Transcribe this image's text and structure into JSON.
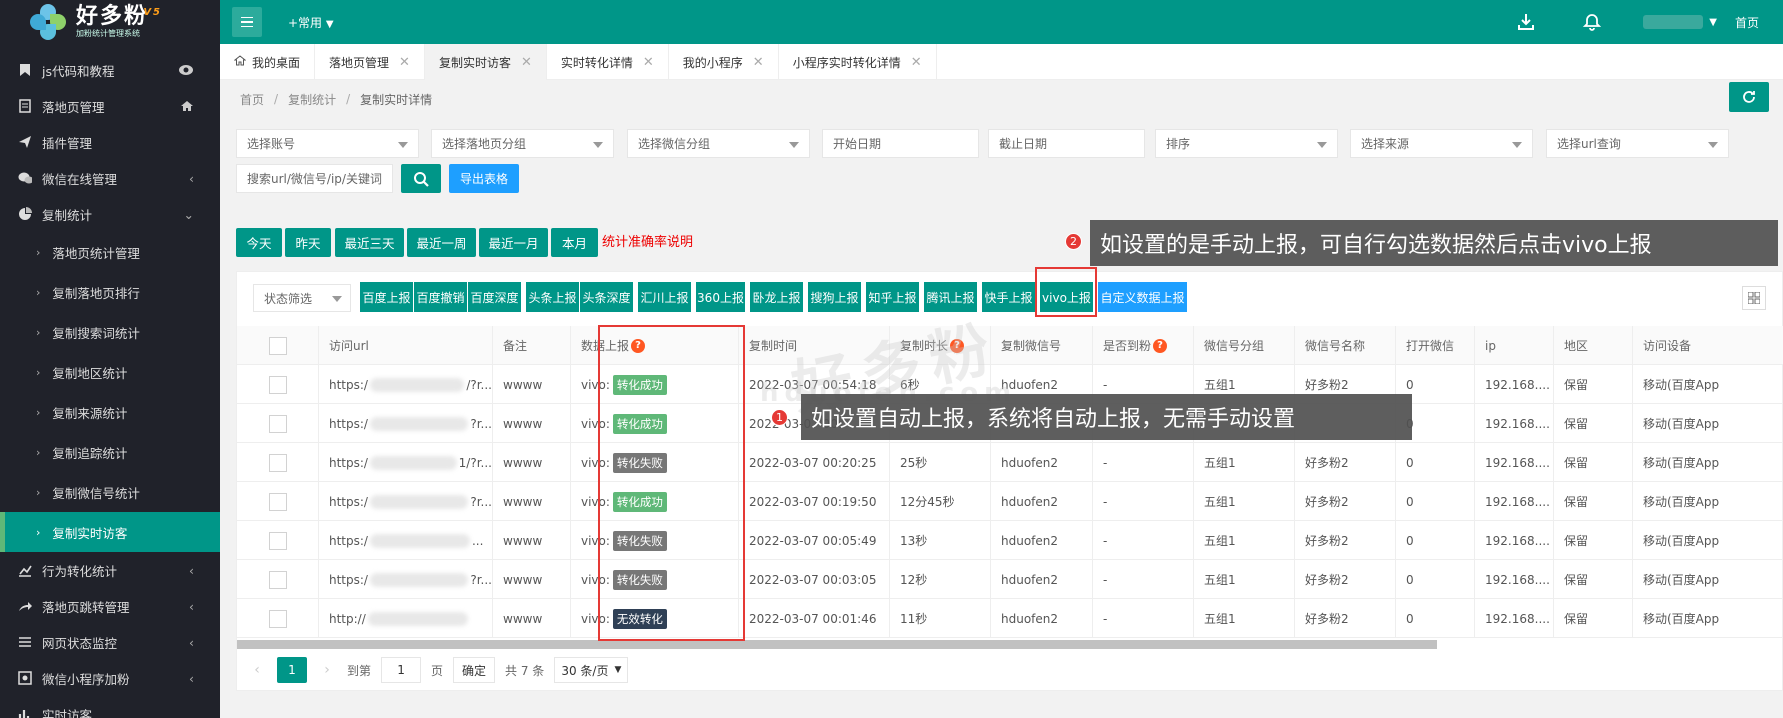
{
  "app": {
    "title": "好多粉",
    "version": "V5",
    "subtitle": "加粉统计管理系统",
    "common": "+常用",
    "home": "首页"
  },
  "sidebar": {
    "items": [
      {
        "label": "js代码和教程",
        "icon": "bookmark-icon",
        "right": "eye"
      },
      {
        "label": "落地页管理",
        "icon": "page-icon",
        "right": "home"
      },
      {
        "label": "插件管理",
        "icon": "send-icon",
        "right": ""
      },
      {
        "label": "微信在线管理",
        "icon": "wechat-icon",
        "right": "chevron"
      },
      {
        "label": "复制统计",
        "icon": "pie-icon",
        "right": "chevron-down"
      }
    ],
    "subitems": [
      "落地页统计管理",
      "复制落地页排行",
      "复制搜索词统计",
      "复制地区统计",
      "复制来源统计",
      "复制追踪统计",
      "复制微信号统计",
      "复制实时访客"
    ],
    "items2": [
      {
        "label": "行为转化统计",
        "icon": "chart-icon"
      },
      {
        "label": "落地页跳转管理",
        "icon": "share-icon"
      },
      {
        "label": "网页状态监控",
        "icon": "list-icon"
      },
      {
        "label": "微信小程序加粉",
        "icon": "mini-icon"
      },
      {
        "label": "实时访客",
        "icon": "bar-icon"
      }
    ]
  },
  "tabs": [
    {
      "label": "我的桌面",
      "close": ""
    },
    {
      "label": "落地页管理",
      "close": "✕"
    },
    {
      "label": "复制实时访客",
      "close": "✕"
    },
    {
      "label": "实时转化详情",
      "close": "✕"
    },
    {
      "label": "我的小程序",
      "close": "✕"
    },
    {
      "label": "小程序实时转化详情",
      "close": "✕"
    }
  ],
  "breadcrumb": [
    "首页",
    "复制统计",
    "复制实时详情"
  ],
  "filters": {
    "selects": [
      "选择账号",
      "选择落地页分组",
      "选择微信分组",
      "开始日期",
      "截止日期",
      "排序",
      "选择来源",
      "选择url查询"
    ],
    "search_placeholder": "搜索url/微信号/ip/关键词",
    "export": "导出表格"
  },
  "quick": [
    "今天",
    "昨天",
    "最近三天",
    "最近一周",
    "最近一月",
    "本月"
  ],
  "quick_note": "统计准确率说明",
  "status_filter": "状态筛选",
  "report_buttons": [
    "百度上报",
    "百度撤销",
    "百度深度",
    "头条上报",
    "头条深度",
    "汇川上报",
    "360上报",
    "卧龙上报",
    "搜狗上报",
    "知乎上报",
    "腾讯上报",
    "快手上报",
    "vivo上报",
    "自定义数据上报"
  ],
  "table": {
    "headers": [
      "",
      "访问url",
      "备注",
      "数据上报",
      "复制时间",
      "复制时长",
      "复制微信号",
      "是否到粉",
      "微信号分组",
      "微信号名称",
      "打开微信",
      "ip",
      "地区",
      "访问设备"
    ],
    "rows": [
      {
        "url_a": "https:/",
        "url_b": "/?r...",
        "note": "wwww",
        "report": "vivo:",
        "status": "转化成功",
        "time": "2022-03-07 00:54:18",
        "dur": "6秒",
        "wx": "hduofen2",
        "fan": "-",
        "group": "五组1",
        "name": "好多粉2",
        "open": "0",
        "ip": "192.168....",
        "region": "保留",
        "device": "移动(百度App"
      },
      {
        "url_a": "https:/",
        "url_b": "?r...",
        "note": "wwww",
        "report": "vivo:",
        "status": "转化成功",
        "time": "2022-03-07 00:",
        "dur": "",
        "wx": "",
        "fan": "",
        "group": "",
        "name": "",
        "open": "0",
        "ip": "192.168....",
        "region": "保留",
        "device": "移动(百度App"
      },
      {
        "url_a": "https:/",
        "url_b": "1/?r...",
        "note": "wwww",
        "report": "vivo:",
        "status": "转化失败",
        "time": "2022-03-07 00:20:25",
        "dur": "25秒",
        "wx": "hduofen2",
        "fan": "-",
        "group": "五组1",
        "name": "好多粉2",
        "open": "0",
        "ip": "192.168....",
        "region": "保留",
        "device": "移动(百度App"
      },
      {
        "url_a": "https:/",
        "url_b": "?r...",
        "note": "wwww",
        "report": "vivo:",
        "status": "转化成功",
        "time": "2022-03-07 00:19:50",
        "dur": "12分45秒",
        "wx": "hduofen2",
        "fan": "-",
        "group": "五组1",
        "name": "好多粉2",
        "open": "0",
        "ip": "192.168....",
        "region": "保留",
        "device": "移动(百度App"
      },
      {
        "url_a": "https:/",
        "url_b": "...",
        "note": "wwww",
        "report": "vivo:",
        "status": "转化失败",
        "time": "2022-03-07 00:05:49",
        "dur": "13秒",
        "wx": "hduofen2",
        "fan": "-",
        "group": "五组1",
        "name": "好多粉2",
        "open": "0",
        "ip": "192.168....",
        "region": "保留",
        "device": "移动(百度App"
      },
      {
        "url_a": "https:/",
        "url_b": "?r...",
        "note": "wwww",
        "report": "vivo:",
        "status": "转化失败",
        "time": "2022-03-07 00:03:05",
        "dur": "12秒",
        "wx": "hduofen2",
        "fan": "-",
        "group": "五组1",
        "name": "好多粉2",
        "open": "0",
        "ip": "192.168....",
        "region": "保留",
        "device": "移动(百度App"
      },
      {
        "url_a": "http://",
        "url_b": "",
        "note": "wwww",
        "report": "vivo:",
        "status": "无效转化",
        "time": "2022-03-07 00:01:46",
        "dur": "11秒",
        "wx": "hduofen2",
        "fan": "-",
        "group": "五组1",
        "name": "好多粉2",
        "open": "0",
        "ip": "192.168....",
        "region": "保留",
        "device": "移动(百度App"
      }
    ]
  },
  "status_colors": {
    "转化成功": "#5fb878",
    "转化失败": "#777777",
    "无效转化": "#2f4056"
  },
  "pager": {
    "current": "1",
    "goto": "到第",
    "page_input": "1",
    "page_unit": "页",
    "confirm": "确定",
    "total": "共 7 条",
    "per_page": "30 条/页"
  },
  "callouts": {
    "one_num": "1",
    "one_text": "如设置自动上报，系统将自动上报，无需手动设置",
    "two_num": "2",
    "two_text": "如设置的是手动上报，可自行勾选数据然后点击vivo上报"
  },
  "watermark": {
    "main": "好多粉",
    "sub": "hduofen.com"
  }
}
